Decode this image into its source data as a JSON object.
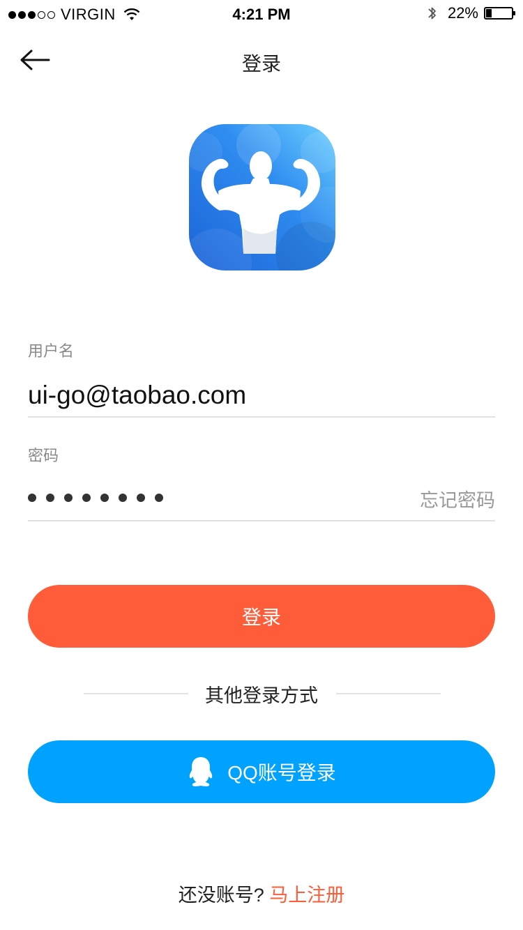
{
  "status_bar": {
    "carrier": "VIRGIN",
    "signal_strength": 3,
    "signal_max": 5,
    "time": "4:21 PM",
    "battery_text": "22%",
    "battery_level": 0.22
  },
  "nav": {
    "title": "登录",
    "back_icon": "back-arrow-icon"
  },
  "logo": {
    "icon": "flexing-muscle-man-icon",
    "colors": [
      "#1E6FE0",
      "#6BC8FF"
    ]
  },
  "form": {
    "username_label": "用户名",
    "username_value": "ui-go@taobao.com",
    "password_label": "密码",
    "password_length": 8,
    "forgot_label": "忘记密码"
  },
  "actions": {
    "login_label": "登录",
    "login_color": "#FF5C39",
    "other_title": "其他登录方式",
    "qq_label": "QQ账号登录",
    "qq_color": "#00A2FF"
  },
  "footer": {
    "prompt": "还没账号?",
    "register_link": "马上注册"
  }
}
